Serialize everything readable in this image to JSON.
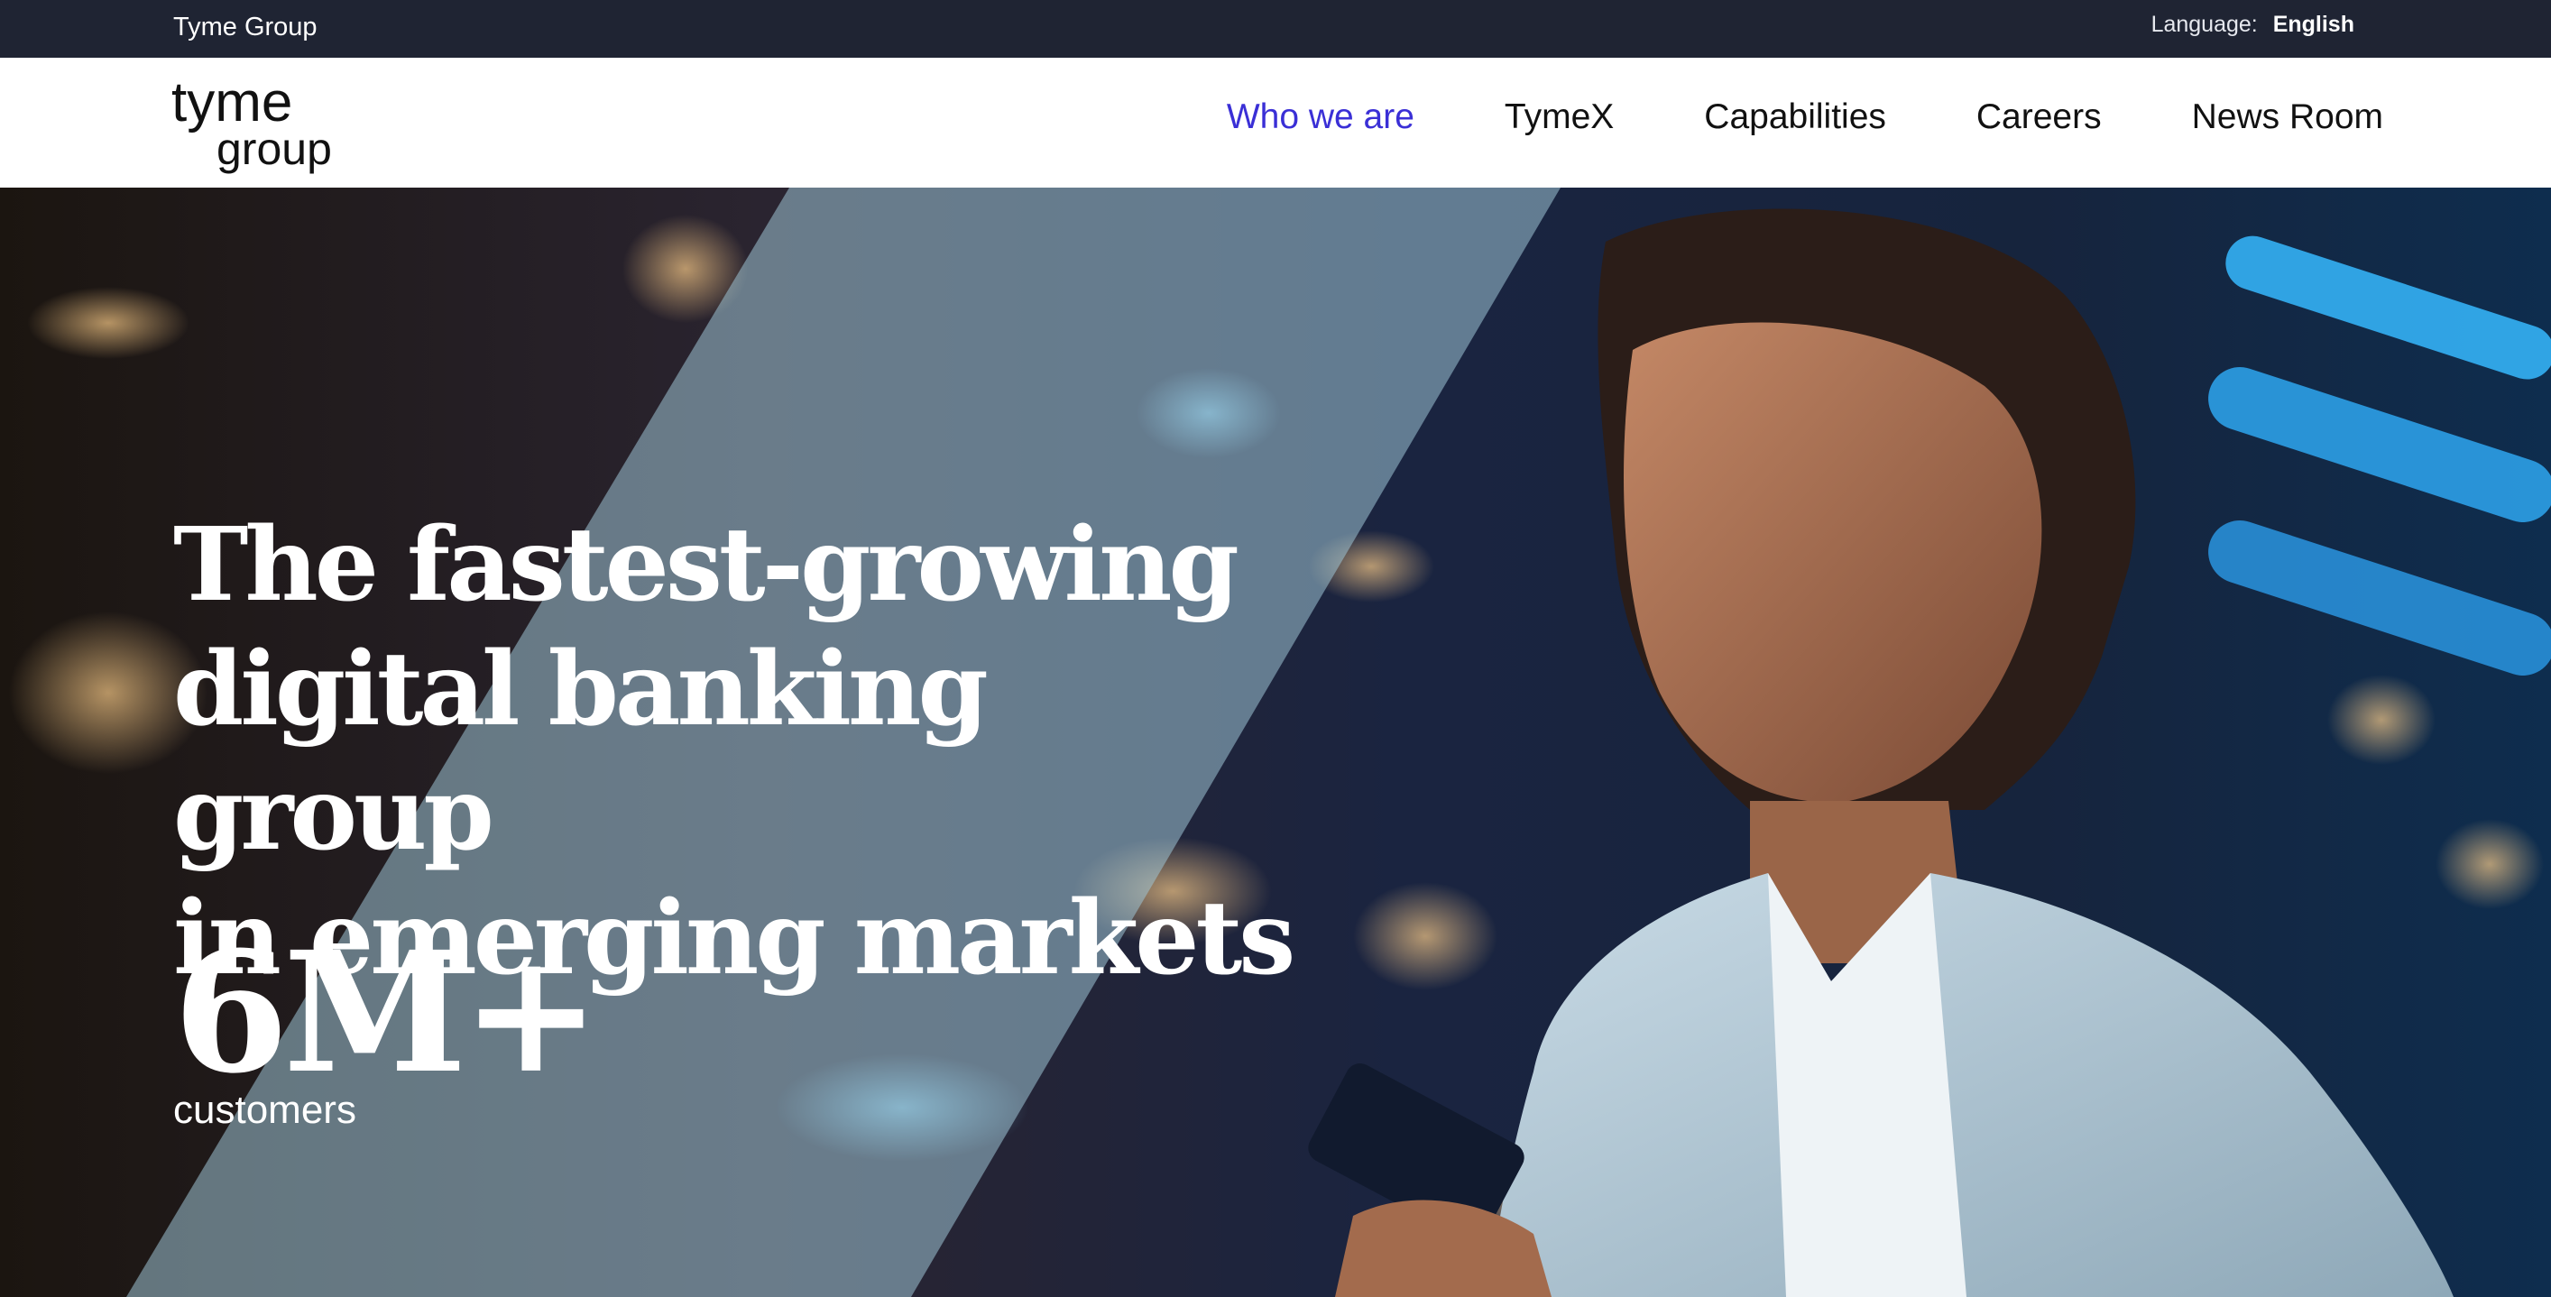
{
  "topbar": {
    "brand": "Tyme Group",
    "language_label": "Language:",
    "language_value": "English"
  },
  "logo": {
    "line1": "tyme",
    "line2": "group"
  },
  "nav": {
    "items": [
      {
        "label": "Who we are",
        "active": true
      },
      {
        "label": "TymeX",
        "active": false
      },
      {
        "label": "Capabilities",
        "active": false
      },
      {
        "label": "Careers",
        "active": false
      },
      {
        "label": "News Room",
        "active": false
      }
    ]
  },
  "hero": {
    "headline_lines": [
      "The fastest-growing",
      "digital banking group",
      "in emerging markets"
    ],
    "stat_value": "6M+",
    "stat_caption": "customers"
  },
  "colors": {
    "topbar_bg": "#1f2433",
    "nav_active": "#3a2fd6",
    "nav_text": "#111111",
    "hero_overlay": "#9fc4d6"
  }
}
